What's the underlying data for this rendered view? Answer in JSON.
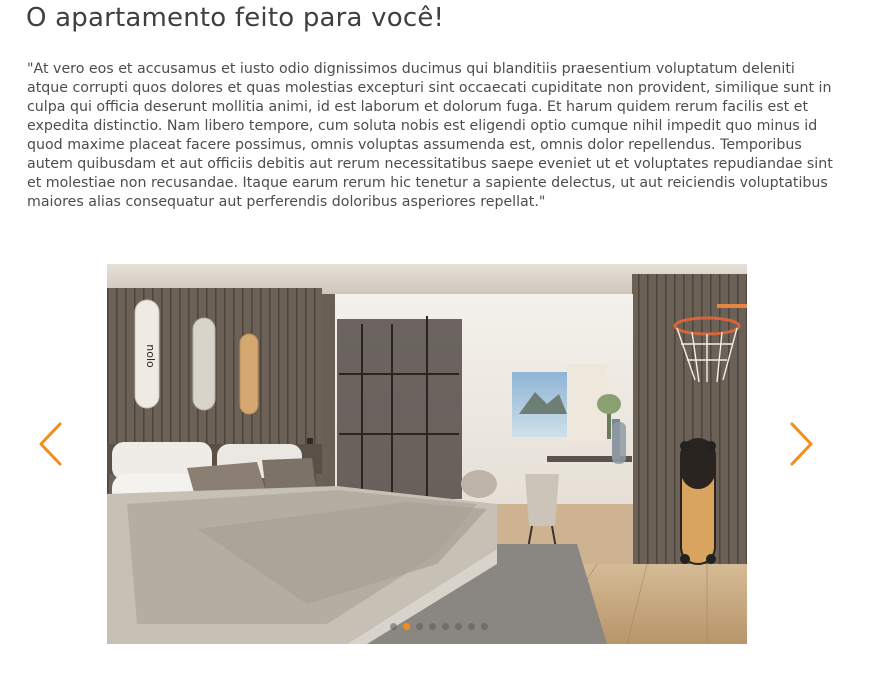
{
  "page": {
    "title": "O apartamento feito para você!",
    "paragraph": "\"At vero eos et accusamus et iusto odio dignissimos ducimus qui blanditiis praesentium voluptatum deleniti atque corrupti quos dolores et quas molestias excepturi sint occaecati cupiditate non provident, similique sunt in culpa qui officia deserunt mollitia animi, id est laborum et dolorum fuga. Et harum quidem rerum facilis est et expedita distinctio. Nam libero tempore, cum soluta nobis est eligendi optio cumque nihil impedit quo minus id quod maxime placeat facere possimus, omnis voluptas assumenda est, omnis dolor repellendus. Temporibus autem quibusdam et aut officiis debitis aut rerum necessitatibus saepe eveniet ut et voluptates repudiandae sint et molestiae non recusandae. Itaque earum rerum hic tenetur a sapiente delectus, ut aut reiciendis voluptatibus maiores alias consequatur aut perferendis doloribus asperiores repellat.\""
  },
  "carousel": {
    "prev_icon": "chevron-left-icon",
    "next_icon": "chevron-right-icon",
    "slide_count": 8,
    "active_index": 1,
    "accent_color": "#f28c1c",
    "slide_subject": "bedroom-photo"
  }
}
